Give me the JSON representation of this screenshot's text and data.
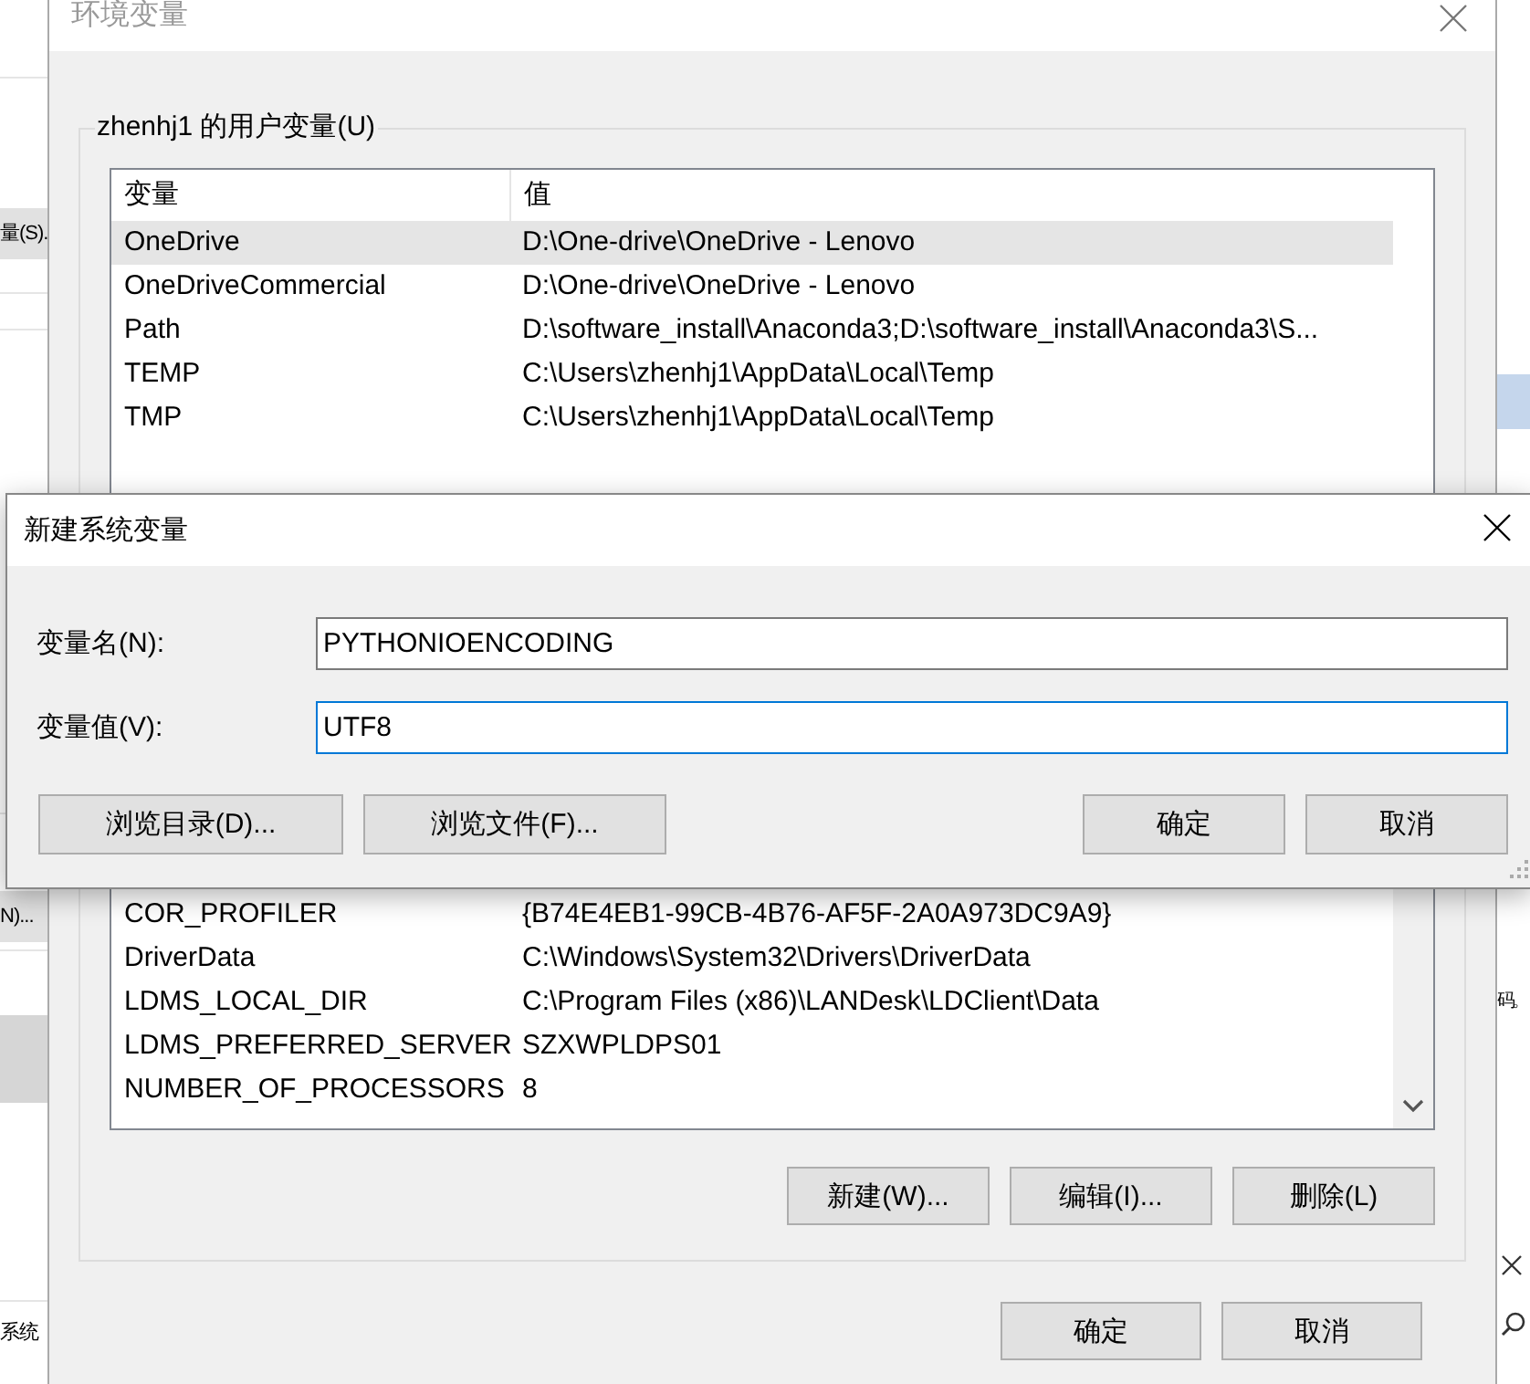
{
  "background_window": {
    "left_texts": [
      {
        "kind": "button",
        "text": "量(S)."
      },
      {
        "kind": "button",
        "text": "N)..."
      },
      {
        "kind": "label",
        "text": "系统"
      }
    ],
    "right_texts": [
      {
        "text": "码。"
      }
    ]
  },
  "main_window": {
    "title": "环境变量",
    "active": false,
    "user_variables": {
      "title": "zhenhj1 的用户变量(U)",
      "columns": [
        "变量",
        "值"
      ],
      "rows": [
        {
          "name": "OneDrive",
          "value": "D:\\One-drive\\OneDrive - Lenovo",
          "hovered": true
        },
        {
          "name": "OneDriveCommercial",
          "value": "D:\\One-drive\\OneDrive - Lenovo",
          "hovered": false
        },
        {
          "name": "Path",
          "value": "D:\\software_install\\Anaconda3;D:\\software_install\\Anaconda3\\S...",
          "hovered": false
        },
        {
          "name": "TEMP",
          "value": "C:\\Users\\zhenhj1\\AppData\\Local\\Temp",
          "hovered": false
        },
        {
          "name": "TMP",
          "value": "C:\\Users\\zhenhj1\\AppData\\Local\\Temp",
          "hovered": false
        }
      ]
    },
    "system_variables": {
      "rows": [
        {
          "name": "COR_PROFILER",
          "value": "{B74E4EB1-99CB-4B76-AF5F-2A0A973DC9A9}",
          "hovered": false
        },
        {
          "name": "DriverData",
          "value": "C:\\Windows\\System32\\Drivers\\DriverData",
          "hovered": false
        },
        {
          "name": "LDMS_LOCAL_DIR",
          "value": "C:\\Program Files (x86)\\LANDesk\\LDClient\\Data",
          "hovered": false
        },
        {
          "name": "LDMS_PREFERRED_SERVER",
          "value": "SZXWPLDPS01",
          "hovered": false
        },
        {
          "name": "NUMBER_OF_PROCESSORS",
          "value": "8",
          "hovered": false
        }
      ],
      "buttons": [
        "新建(W)...",
        "编辑(I)...",
        "删除(L)"
      ]
    },
    "buttons": [
      "确定",
      "取消"
    ]
  },
  "dialog": {
    "title": "新建系统变量",
    "fields": [
      {
        "label": "变量名(N):",
        "value": "PYTHONIOENCODING",
        "focused": false
      },
      {
        "label": "变量值(V):",
        "value": "UTF8",
        "focused": true
      }
    ],
    "left_buttons": [
      "浏览目录(D)...",
      "浏览文件(F)..."
    ],
    "right_buttons": [
      "确定",
      "取消"
    ]
  }
}
